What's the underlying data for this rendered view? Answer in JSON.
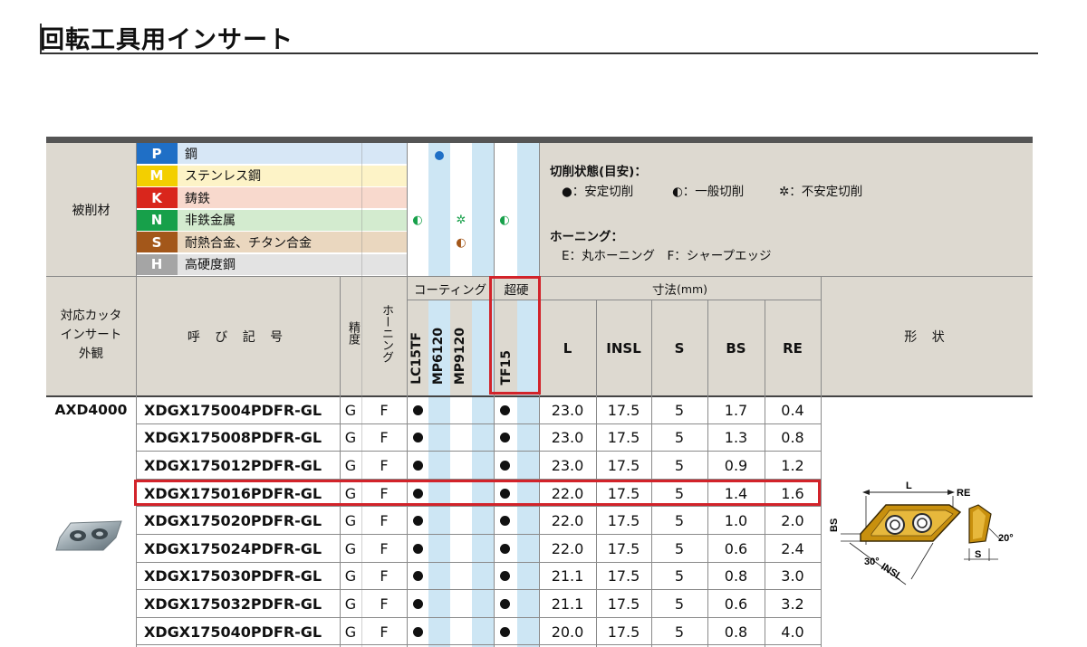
{
  "title": "回転工具用インサート",
  "work_material": {
    "label": "被削材",
    "groups": [
      {
        "letter": "P",
        "name": "鋼",
        "color": "#1f6fc6",
        "bg": "#d7e7f6"
      },
      {
        "letter": "M",
        "name": "ステンレス鋼",
        "color": "#f3cf00",
        "bg": "#fdf3c7"
      },
      {
        "letter": "K",
        "name": "鋳鉄",
        "color": "#d9261c",
        "bg": "#f8d9cd"
      },
      {
        "letter": "N",
        "name": "非鉄金属",
        "color": "#17a04a",
        "bg": "#d3ebcf"
      },
      {
        "letter": "S",
        "name": "耐熱合金、チタン合金",
        "color": "#a3571a",
        "bg": "#ead7bf"
      },
      {
        "letter": "H",
        "name": "高硬度鋼",
        "color": "#a5a5a5",
        "bg": "#e3e3e3"
      }
    ]
  },
  "legend": {
    "cutting_title": "切削状態(目安)：",
    "stable": "●：安定切削",
    "general": "◐：一般切削",
    "unstable": "✲：不安定切削",
    "honing_title": "ホーニング：",
    "honing_desc": "E：丸ホーニング　F：シャープエッジ"
  },
  "headers": {
    "cutter": [
      "対応カッタ",
      "インサート",
      "外観"
    ],
    "code": "呼 び 記 号",
    "precision": "精度",
    "honing": "ホーニング",
    "coating": "コーティング",
    "carbide": "超硬",
    "dims": "寸法",
    "dims_unit": "(mm)",
    "grades": [
      "LC15TF",
      "MP6120",
      "MP9120",
      "TF15"
    ],
    "dim_cols": [
      "L",
      "INSL",
      "S",
      "BS",
      "RE"
    ],
    "shape": "形 状"
  },
  "cutter_name": "AXD4000",
  "rows": [
    {
      "code": "XDGX175004PDFR-GL",
      "prec": "G",
      "hon": "F",
      "L": "23.0",
      "INSL": "17.5",
      "S": "5",
      "BS": "1.7",
      "RE": "0.4"
    },
    {
      "code": "XDGX175008PDFR-GL",
      "prec": "G",
      "hon": "F",
      "L": "23.0",
      "INSL": "17.5",
      "S": "5",
      "BS": "1.3",
      "RE": "0.8"
    },
    {
      "code": "XDGX175012PDFR-GL",
      "prec": "G",
      "hon": "F",
      "L": "23.0",
      "INSL": "17.5",
      "S": "5",
      "BS": "0.9",
      "RE": "1.2"
    },
    {
      "code": "XDGX175016PDFR-GL",
      "prec": "G",
      "hon": "F",
      "L": "22.0",
      "INSL": "17.5",
      "S": "5",
      "BS": "1.4",
      "RE": "1.6"
    },
    {
      "code": "XDGX175020PDFR-GL",
      "prec": "G",
      "hon": "F",
      "L": "22.0",
      "INSL": "17.5",
      "S": "5",
      "BS": "1.0",
      "RE": "2.0"
    },
    {
      "code": "XDGX175024PDFR-GL",
      "prec": "G",
      "hon": "F",
      "L": "22.0",
      "INSL": "17.5",
      "S": "5",
      "BS": "0.6",
      "RE": "2.4"
    },
    {
      "code": "XDGX175030PDFR-GL",
      "prec": "G",
      "hon": "F",
      "L": "21.1",
      "INSL": "17.5",
      "S": "5",
      "BS": "0.8",
      "RE": "3.0"
    },
    {
      "code": "XDGX175032PDFR-GL",
      "prec": "G",
      "hon": "F",
      "L": "21.1",
      "INSL": "17.5",
      "S": "5",
      "BS": "0.6",
      "RE": "3.2"
    },
    {
      "code": "XDGX175040PDFR-GL",
      "prec": "G",
      "hon": "F",
      "L": "20.0",
      "INSL": "17.5",
      "S": "5",
      "BS": "0.8",
      "RE": "4.0"
    }
  ],
  "highlight_color": "#d2232a",
  "diagram": {
    "L": "L",
    "RE": "RE",
    "BS": "BS",
    "S": "S",
    "angle1": "30°",
    "angle2": "20°",
    "INSL": "INSL"
  }
}
